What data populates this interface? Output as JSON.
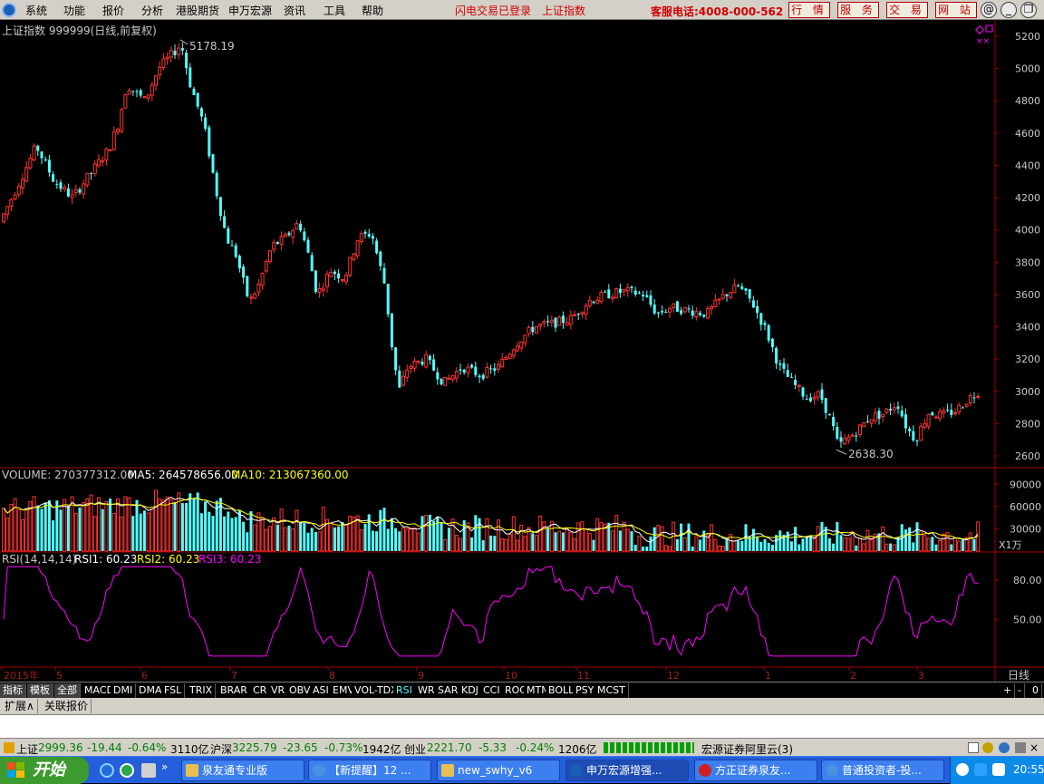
{
  "menu": {
    "items": [
      "系统",
      "功能",
      "报价",
      "分析",
      "港股期货",
      "申万宏源",
      "资讯",
      "工具",
      "帮助"
    ]
  },
  "header_status": {
    "login": "闪电交易已登录",
    "index": "上证指数",
    "hotline": "客服电话:4008-000-562"
  },
  "top_buttons": [
    "行 情",
    "服 务",
    "交 易",
    "网 站"
  ],
  "window_controls": [
    "@",
    "_",
    "❐",
    "×"
  ],
  "kline": {
    "title": "上证指数 999999(日线,前复权)",
    "high_label": "5178.19",
    "low_label": "2638.30",
    "y_ticks": [
      "5200",
      "5000",
      "4800",
      "4600",
      "4400",
      "4200",
      "4000",
      "3800",
      "3600",
      "3400",
      "3200",
      "3000",
      "2800",
      "2600"
    ],
    "up_color": "#ff3232",
    "down_color": "#54ffff"
  },
  "volume": {
    "label": "VOLUME: 270377312.00",
    "ma5": "MA5: 264578656.00",
    "ma10": "MA10: 213067360.00",
    "y_ticks": [
      "90000",
      "60000",
      "30000"
    ],
    "unit": "X1万"
  },
  "rsi": {
    "label": "RSI(14,14,14)",
    "rsi1": "RSI1: 60.23",
    "rsi2": "RSI2: 60.23",
    "rsi3": "RSI3: 60.23",
    "y_ticks": [
      "80.00",
      "50.00"
    ]
  },
  "time_axis": {
    "labels": [
      "2015年",
      "5",
      "6",
      "7",
      "8",
      "9",
      "10",
      "11",
      "12",
      "1",
      "2",
      "3"
    ],
    "period": "日线"
  },
  "indicator_tabs": [
    "指标",
    "模板",
    "全部",
    "MACD",
    "DMI",
    "DMA",
    "FSL",
    "TRIX",
    "BRAR",
    "CR",
    "VR",
    "OBV",
    "ASI",
    "EMV",
    "VOL-TDX",
    "RSI",
    "WR",
    "SAR",
    "KDJ",
    "CCI",
    "ROC",
    "MTM",
    "BOLL",
    "PSY",
    "MCST"
  ],
  "indicator_active": "RSI",
  "tab_controls": [
    "+",
    "-",
    "0"
  ],
  "ext_tabs": [
    "扩展∧",
    "关联报价"
  ],
  "status": {
    "sh_name": "上证",
    "sh_price": "2999.36",
    "sh_chg": "-19.44",
    "sh_pct": "-0.64%",
    "sh_amt": "3110亿",
    "hs_name": "沪深",
    "hs_price": "3225.79",
    "hs_chg": "-23.65",
    "hs_pct": "-0.73%",
    "hs_amt": "1942亿",
    "cy_name": "创业",
    "cy_price": "2221.70",
    "cy_chg": "-5.33",
    "cy_pct": "-0.24%",
    "cy_amt": "1206亿",
    "server": "宏源证券阿里云(3)"
  },
  "taskbar": {
    "start": "开始",
    "tasks": [
      "泉友通专业版",
      "【新提醒】12 ...",
      "new_swhy_v6",
      "申万宏源增强...",
      "方正证券泉友...",
      "普通投资者-投..."
    ],
    "clock": "20:55"
  }
}
